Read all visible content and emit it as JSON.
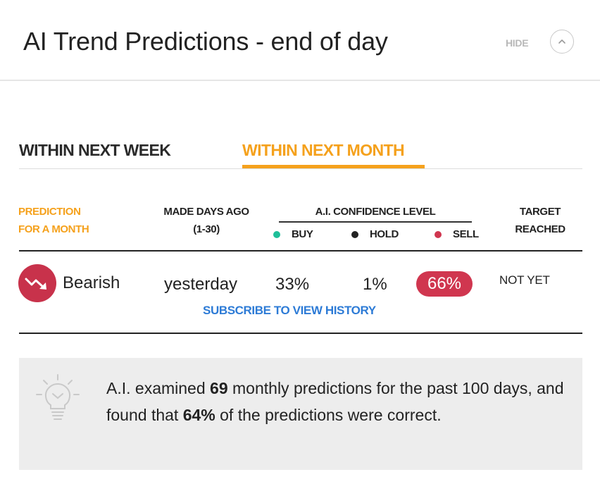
{
  "header": {
    "title": "AI Trend Predictions - end of day",
    "hide_label": "HIDE"
  },
  "tabs": [
    {
      "label": "WITHIN NEXT WEEK",
      "active": false
    },
    {
      "label": "WITHIN NEXT MONTH",
      "active": true
    }
  ],
  "table": {
    "headers": {
      "prediction_line1": "PREDICTION",
      "prediction_line2": "FOR A MONTH",
      "made_line1": "MADE DAYS AGO",
      "made_line2": "(1-30)",
      "confidence": "A.I. CONFIDENCE LEVEL",
      "target_line1": "TARGET",
      "target_line2": "REACHED"
    },
    "legend": [
      {
        "label": "BUY",
        "color": "#1fbf99"
      },
      {
        "label": "HOLD",
        "color": "#222222"
      },
      {
        "label": "SELL",
        "color": "#d0364f"
      }
    ],
    "row": {
      "trend": "Bearish",
      "trend_icon": "trend-down-icon",
      "made": "yesterday",
      "buy": "33%",
      "hold": "1%",
      "sell": "66%",
      "target": "NOT YET"
    },
    "subscribe_label": "SUBSCRIBE TO VIEW HISTORY"
  },
  "info": {
    "icon": "lightbulb-icon",
    "text_part1": "A.I. examined ",
    "count": "69",
    "text_part2": " monthly predictions for the past 100 days, and found that ",
    "percent": "64%",
    "text_part3": " of the predictions were correct."
  },
  "colors": {
    "accent": "#f5a11c",
    "bearish": "#c8324b",
    "link": "#2d7bd6"
  }
}
